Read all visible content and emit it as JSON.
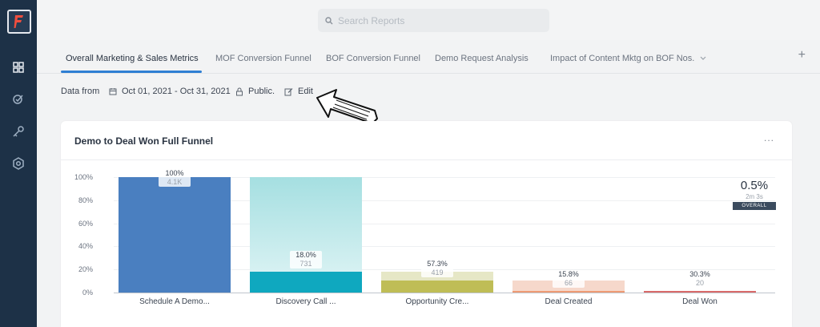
{
  "search": {
    "placeholder": "Search Reports"
  },
  "tabs": [
    {
      "label": "Overall Marketing & Sales Metrics",
      "active": true
    },
    {
      "label": "MOF Conversion Funnel"
    },
    {
      "label": "BOF Conversion Funnel"
    },
    {
      "label": "Demo Request Analysis"
    },
    {
      "label": "Impact of Content Mktg on BOF Nos."
    }
  ],
  "tab_add_label": "+",
  "filter": {
    "data_from_label": "Data from",
    "date_range": "Oct 01, 2021 - Oct 31, 2021",
    "visibility": "Public.",
    "edit_label": "Edit"
  },
  "card": {
    "title": "Demo to Deal Won Full Funnel",
    "more_label": "...",
    "overall": {
      "value": "0.5%",
      "time": "2m 3s",
      "badge": "OVERALL"
    }
  },
  "colors": {
    "sidebar": "#1d3147",
    "accent": "#2f7fd3",
    "bar1": "#4a7fc0",
    "bar2_top": "#a5dfe1",
    "bar2_fill": "#0fa8bf",
    "bar3_top": "#e6e7c6",
    "bar3_fill": "#bfbd56",
    "bar4_top": "#f6d8cb",
    "bar4_fill": "#ee9a74",
    "bar5_fill": "#d96a6a"
  },
  "chart_data": {
    "type": "bar",
    "categories": [
      "Schedule A Demo...",
      "Discovery Call ...",
      "Opportunity Cre...",
      "Deal Created",
      "Deal Won"
    ],
    "conversion_pct_labels": [
      "100%",
      "18.0%",
      "57.3%",
      "15.8%",
      "30.3%"
    ],
    "count_labels": [
      "4.1K",
      "731",
      "419",
      "66",
      "20"
    ],
    "values_pct_of_first": [
      100,
      18.0,
      10.3,
      1.6,
      0.5
    ],
    "previous_stage_pct": [
      null,
      100,
      18.0,
      10.3,
      1.6
    ],
    "yticks": [
      "100%",
      "80%",
      "60%",
      "40%",
      "20%",
      "0%"
    ],
    "ylim": [
      0,
      100
    ]
  }
}
